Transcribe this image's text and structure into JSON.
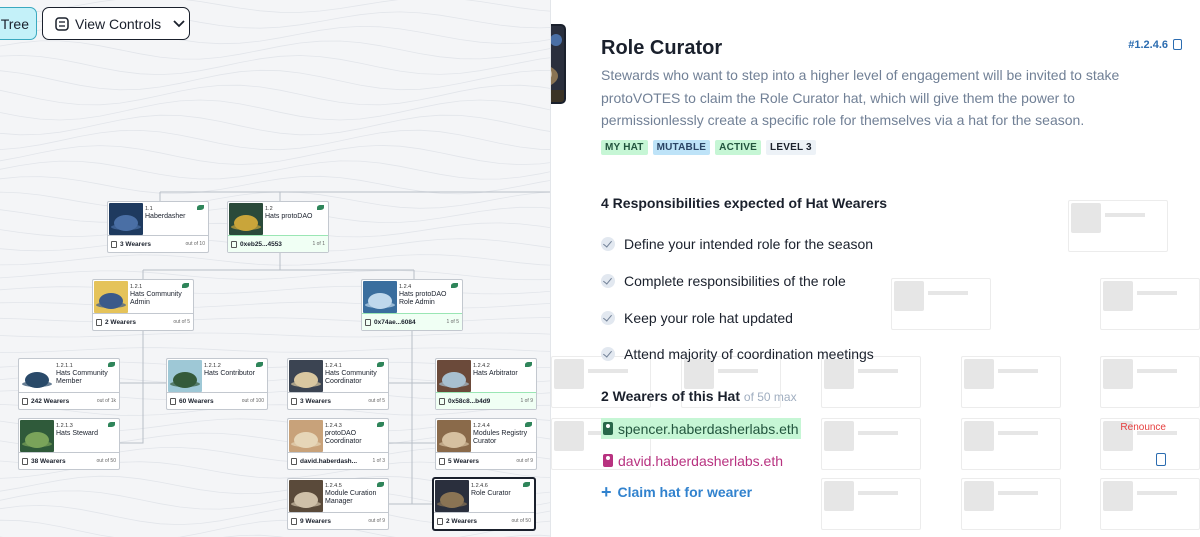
{
  "toolbar": {
    "tree_label": "Tree",
    "view_controls_label": "View Controls"
  },
  "tree": {
    "nodes": [
      {
        "id": "1.1",
        "name": "Haberdasher",
        "wearers": "3 Wearers",
        "max": "out of 10",
        "green": false
      },
      {
        "id": "1.2",
        "name": "Hats protoDAO",
        "wearers": "0xeb25...4553",
        "max": "1 of 1",
        "green": true
      },
      {
        "id": "1.2.1",
        "name": "Hats Community Admin",
        "wearers": "2 Wearers",
        "max": "out of 5",
        "green": false
      },
      {
        "id": "1.2.4",
        "name": "Hats protoDAO Role Admin",
        "wearers": "0x74ae...6084",
        "max": "1 of 5",
        "green": true
      },
      {
        "id": "1.2.1.1",
        "name": "Hats Community Member",
        "wearers": "242 Wearers",
        "max": "out of 1k",
        "green": false
      },
      {
        "id": "1.2.1.2",
        "name": "Hats Contributor",
        "wearers": "60 Wearers",
        "max": "out of 100",
        "green": false
      },
      {
        "id": "1.2.4.1",
        "name": "Hats Community Coordinator",
        "wearers": "3 Wearers",
        "max": "out of 5",
        "green": false
      },
      {
        "id": "1.2.4.2",
        "name": "Hats Arbitrator",
        "wearers": "0x58c8...b4d9",
        "max": "1 of 9",
        "green": true
      },
      {
        "id": "1.2.1.3",
        "name": "Hats Steward",
        "wearers": "38 Wearers",
        "max": "out of 50",
        "green": false
      },
      {
        "id": "1.2.4.3",
        "name": "protoDAO Coordinator",
        "wearers": "david.haberdash...",
        "max": "1 of 3",
        "green": false
      },
      {
        "id": "1.2.4.4",
        "name": "Modules Registry Curator",
        "wearers": "5 Wearers",
        "max": "out of 9",
        "green": false
      },
      {
        "id": "1.2.4.5",
        "name": "Module Curation Manager",
        "wearers": "9 Wearers",
        "max": "out of 9",
        "green": false
      },
      {
        "id": "1.2.4.6",
        "name": "Role Curator",
        "wearers": "2 Wearers",
        "max": "out of 50",
        "green": false
      }
    ]
  },
  "hat": {
    "title": "Role Curator",
    "id": "#1.2.4.6",
    "description": "Stewards who want to step into a higher level of engagement will be invited to stake protoVOTES to claim the Role Curator hat, which will give them the power to permissionlessly create a specific role for themselves via a hat for the season.",
    "badges": [
      "MY HAT",
      "MUTABLE",
      "ACTIVE",
      "LEVEL 3"
    ]
  },
  "responsibilities": {
    "title": "4 Responsibilities expected of Hat Wearers",
    "items": [
      "Define your intended role for the season",
      "Complete responsibilities of the role",
      "Keep your role hat updated",
      "Attend majority of coordination meetings"
    ]
  },
  "wearers": {
    "title": "2 Wearers of this Hat",
    "max": "of 50 max",
    "list": [
      "spencer.haberdasherlabs.eth",
      "david.haberdasherlabs.eth"
    ],
    "renounce_label": "Renounce",
    "claim_label": "Claim hat for wearer"
  },
  "colors": {
    "accent": "#3182ce",
    "wearer_green": "#276749",
    "wearer_pink": "#b83280",
    "renounce_red": "#e53e3e"
  }
}
